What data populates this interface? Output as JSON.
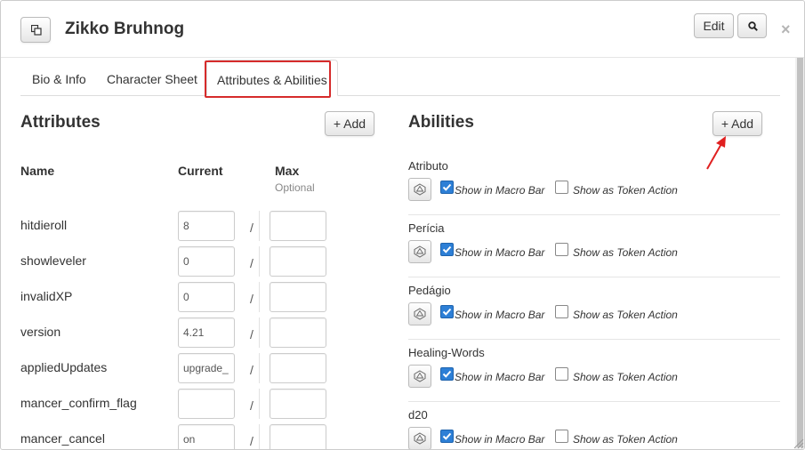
{
  "title_bar": {
    "character_name": "Zikko Bruhnog",
    "edit_label": "Edit",
    "close_glyph": "×",
    "popout_icon": "popout-icon",
    "search_icon": "search-icon"
  },
  "tabs": [
    {
      "label": "Bio & Info",
      "active": false
    },
    {
      "label": "Character Sheet",
      "active": false
    },
    {
      "label": "Attributes & Abilities",
      "active": true
    }
  ],
  "attributes": {
    "title": "Attributes",
    "add_label": "+ Add",
    "col_name": "Name",
    "col_current": "Current",
    "col_max": "Max",
    "col_max_sub": "Optional",
    "slash": "/",
    "rows": [
      {
        "name": "hitdieroll",
        "current": "8",
        "max": ""
      },
      {
        "name": "showleveler",
        "current": "0",
        "max": ""
      },
      {
        "name": "invalidXP",
        "current": "0",
        "max": ""
      },
      {
        "name": "version",
        "current": "4.21",
        "max": ""
      },
      {
        "name": "appliedUpdates",
        "current": "upgrade_",
        "max": ""
      },
      {
        "name": "mancer_confirm_flag",
        "current": "",
        "max": ""
      },
      {
        "name": "mancer_cancel",
        "current": "on",
        "max": ""
      }
    ]
  },
  "abilities": {
    "title": "Abilities",
    "add_label": "+ Add",
    "macro_bar_label": "Show in Macro Bar",
    "token_action_label": "Show as Token Action",
    "rows": [
      {
        "name": "Atributo",
        "macro_bar": true,
        "token_action": false
      },
      {
        "name": "Perícia",
        "macro_bar": true,
        "token_action": false
      },
      {
        "name": "Pedágio",
        "macro_bar": true,
        "token_action": false
      },
      {
        "name": "Healing-Words",
        "macro_bar": true,
        "token_action": false
      },
      {
        "name": "d20",
        "macro_bar": true,
        "token_action": false
      }
    ]
  },
  "colors": {
    "highlight": "#d62b2b",
    "checkbox_checked": "#2d7fd6"
  }
}
